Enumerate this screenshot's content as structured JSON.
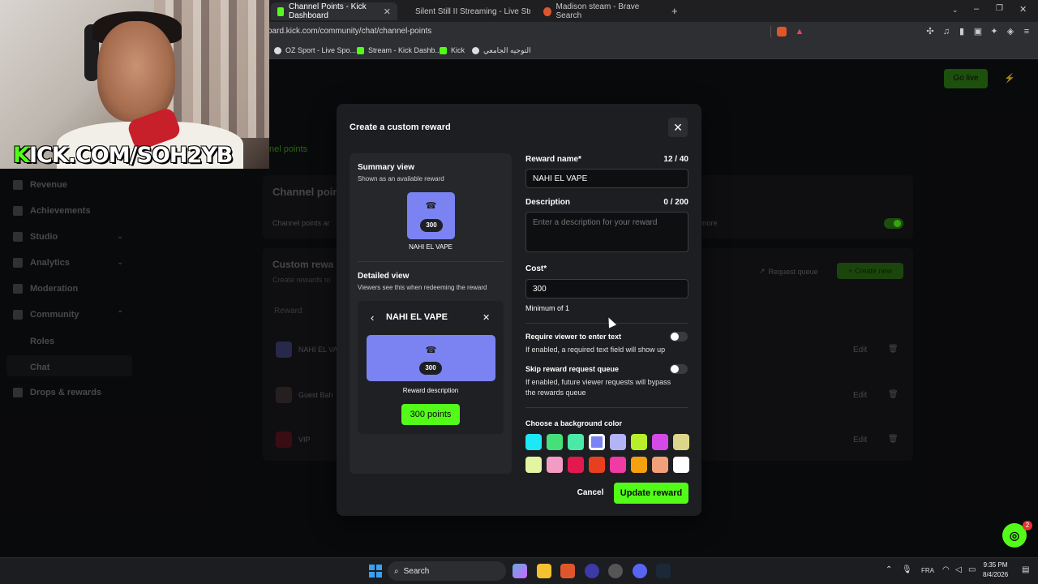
{
  "browser": {
    "tabs": [
      {
        "label": "Channel Points - Kick Dashboard",
        "active": true
      },
      {
        "label": "Silent Still II Streaming - Live Stream",
        "active": false
      },
      {
        "label": "Madison steam - Brave Search",
        "active": false
      }
    ],
    "new_tab": "+",
    "url": "oard.kick.com/community/chat/channel-points",
    "bookmarks": [
      "OZ Sport - Live Spo...",
      "Stream - Kick Dashb...",
      "Kick",
      "التوجيه الجامعي"
    ]
  },
  "webcam": {
    "overlay_prefix": "K",
    "overlay_text": "ICK.COM/SOH2YB"
  },
  "sidebar": {
    "items": [
      "Revenue",
      "Achievements",
      "Studio",
      "Analytics",
      "Moderation",
      "Community",
      "Roles",
      "Chat",
      "Drops & rewards"
    ]
  },
  "background_page": {
    "tab_label": "nel points",
    "go_live": "Go live",
    "section_title": "Channel point",
    "toggle_row_text": "Channel points ar",
    "more_text": "more",
    "custom_title": "Custom rewa",
    "custom_sub": "Create rewards to",
    "request_queue": "Request queue",
    "create_new": "Create new",
    "col_reward": "Reward",
    "rows": [
      {
        "name": "NAHI EL VA",
        "edit": "Edit"
      },
      {
        "name": "Guest Bah",
        "edit": "Edit"
      },
      {
        "name": "VIP",
        "edit": "Edit"
      }
    ]
  },
  "modal": {
    "title": "Create a custom reward",
    "summary_label": "Summary view",
    "summary_sub": "Shown as an available reward",
    "tile_cost": "300",
    "tile_name": "NAHI EL VAPE",
    "detailed_label": "Detailed view",
    "detailed_sub": "Viewers see this when redeeming the reward",
    "detail_title": "NAHI EL VAPE",
    "detail_cost": "300",
    "reward_description": "Reward description",
    "points_button": "300 points",
    "reward_name_label": "Reward name*",
    "reward_name_count": "12 / 40",
    "reward_name_value": "NAHI EL VAPE",
    "description_label": "Description",
    "description_count": "0 / 200",
    "description_placeholder": "Enter a description for your reward",
    "cost_label": "Cost*",
    "cost_value": "300",
    "cost_hint": "Minimum of 1",
    "require_text_label": "Require viewer to enter text",
    "require_text_desc": "If enabled, a required text field will show up",
    "skip_queue_label": "Skip reward request queue",
    "skip_queue_desc1": "If enabled, future viewer requests will bypass",
    "skip_queue_desc2": "the rewards queue",
    "bg_color_label": "Choose a background color",
    "colors_row1": [
      "#1ee8f5",
      "#46e07a",
      "#4be8a8",
      "#7b83f2",
      "#b3b3f7",
      "#b7f02a",
      "#d44ae8",
      "#dcd68a"
    ],
    "colors_row2": [
      "#e4f5a2",
      "#f29cc5",
      "#e3184e",
      "#e8401f",
      "#f03aa4",
      "#f5a00f",
      "#f2a07a",
      "#ffffff"
    ],
    "selected_color": "#7b83f2",
    "cancel": "Cancel",
    "update": "Update reward"
  },
  "taskbar": {
    "search": "Search",
    "lang": "FRA",
    "time": "9:35 PM",
    "date": "8/4/2026",
    "support_badge": "2"
  }
}
